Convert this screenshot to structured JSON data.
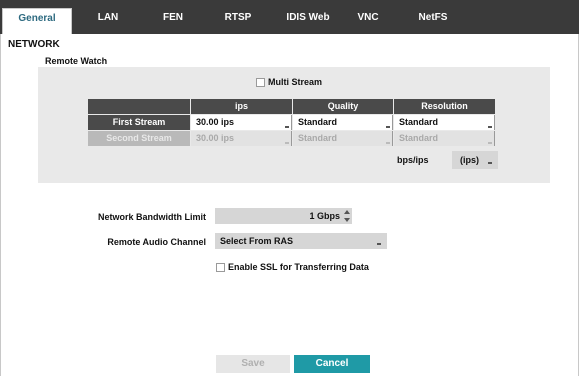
{
  "tabs": [
    {
      "label": "General",
      "active": true
    },
    {
      "label": "LAN"
    },
    {
      "label": "FEN"
    },
    {
      "label": "RTSP"
    },
    {
      "label": "IDIS Web"
    },
    {
      "label": "VNC"
    },
    {
      "label": "NetFS"
    }
  ],
  "section_title": "NETWORK",
  "remote_watch": {
    "title": "Remote Watch",
    "multi_stream_label": "Multi Stream",
    "table": {
      "headers": [
        "ips",
        "Quality",
        "Resolution"
      ],
      "rows": [
        {
          "name": "First Stream",
          "ips": "30.00 ips",
          "quality": "Standard",
          "resolution": "Standard",
          "enabled": true
        },
        {
          "name": "Second Stream",
          "ips": "30.00 ips",
          "quality": "Standard",
          "resolution": "Standard",
          "enabled": false
        }
      ]
    },
    "unit_label": "bps/ips",
    "unit_value": "(ips)"
  },
  "bandwidth": {
    "label": "Network Bandwidth Limit",
    "value": "1 Gbps"
  },
  "audio": {
    "label": "Remote Audio Channel",
    "value": "Select From RAS"
  },
  "ssl_label": "Enable SSL for Transferring Data",
  "buttons": {
    "save": "Save",
    "cancel": "Cancel"
  },
  "colors": {
    "tab_bar": "#3a3a3a",
    "active_tab_text": "#2d6a80",
    "cancel_button": "#1f9aa6"
  }
}
